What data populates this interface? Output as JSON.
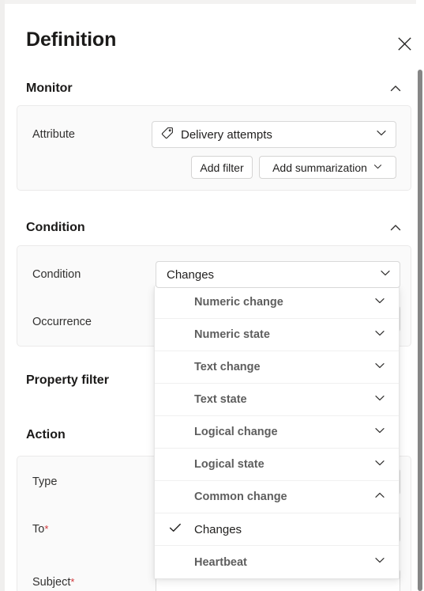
{
  "panel": {
    "title": "Definition",
    "close_icon": "close-icon"
  },
  "sections": {
    "monitor": {
      "title": "Monitor",
      "chevron_icon": "chevron-up-icon",
      "attribute_label": "Attribute",
      "attribute_value": "Delivery attempts",
      "attribute_icon": "tag-icon",
      "attribute_chevron_icon": "chevron-down-icon",
      "add_filter_label": "Add filter",
      "add_summarization_label": "Add summarization",
      "add_summarization_chevron_icon": "chevron-down-icon"
    },
    "condition": {
      "title": "Condition",
      "chevron_icon": "chevron-up-icon",
      "condition_label": "Condition",
      "condition_value": "Changes",
      "condition_chevron_icon": "chevron-down-icon",
      "occurrence_label": "Occurrence"
    },
    "property_filter": {
      "title": "Property filter"
    },
    "action": {
      "title": "Action",
      "type_label": "Type",
      "to_label": "To",
      "to_required": "*",
      "subject_label": "Subject",
      "subject_required": "*"
    }
  },
  "condition_menu": {
    "items": [
      {
        "label": "Numeric change",
        "icon": "chevron-down-icon",
        "selected": false,
        "expanded": false
      },
      {
        "label": "Numeric state",
        "icon": "chevron-down-icon",
        "selected": false,
        "expanded": false
      },
      {
        "label": "Text change",
        "icon": "chevron-down-icon",
        "selected": false,
        "expanded": false
      },
      {
        "label": "Text state",
        "icon": "chevron-down-icon",
        "selected": false,
        "expanded": false
      },
      {
        "label": "Logical change",
        "icon": "chevron-down-icon",
        "selected": false,
        "expanded": false
      },
      {
        "label": "Logical state",
        "icon": "chevron-down-icon",
        "selected": false,
        "expanded": false
      },
      {
        "label": "Common change",
        "icon": "chevron-up-icon",
        "selected": false,
        "expanded": true
      },
      {
        "label": "Changes",
        "icon": "check-icon",
        "selected": true,
        "expanded": false
      },
      {
        "label": "Heartbeat",
        "icon": "chevron-down-icon",
        "selected": false,
        "expanded": false
      }
    ]
  },
  "colors": {
    "panel_background": "#ffffff",
    "card_background": "#fafafa",
    "card_border": "#ebeaea",
    "text_primary": "#1b1a19",
    "text_secondary": "#5e5e5e",
    "required_asterisk": "#d13438",
    "scrollbar_thumb": "#868686"
  },
  "scrollbar": {
    "orientation": "vertical"
  }
}
